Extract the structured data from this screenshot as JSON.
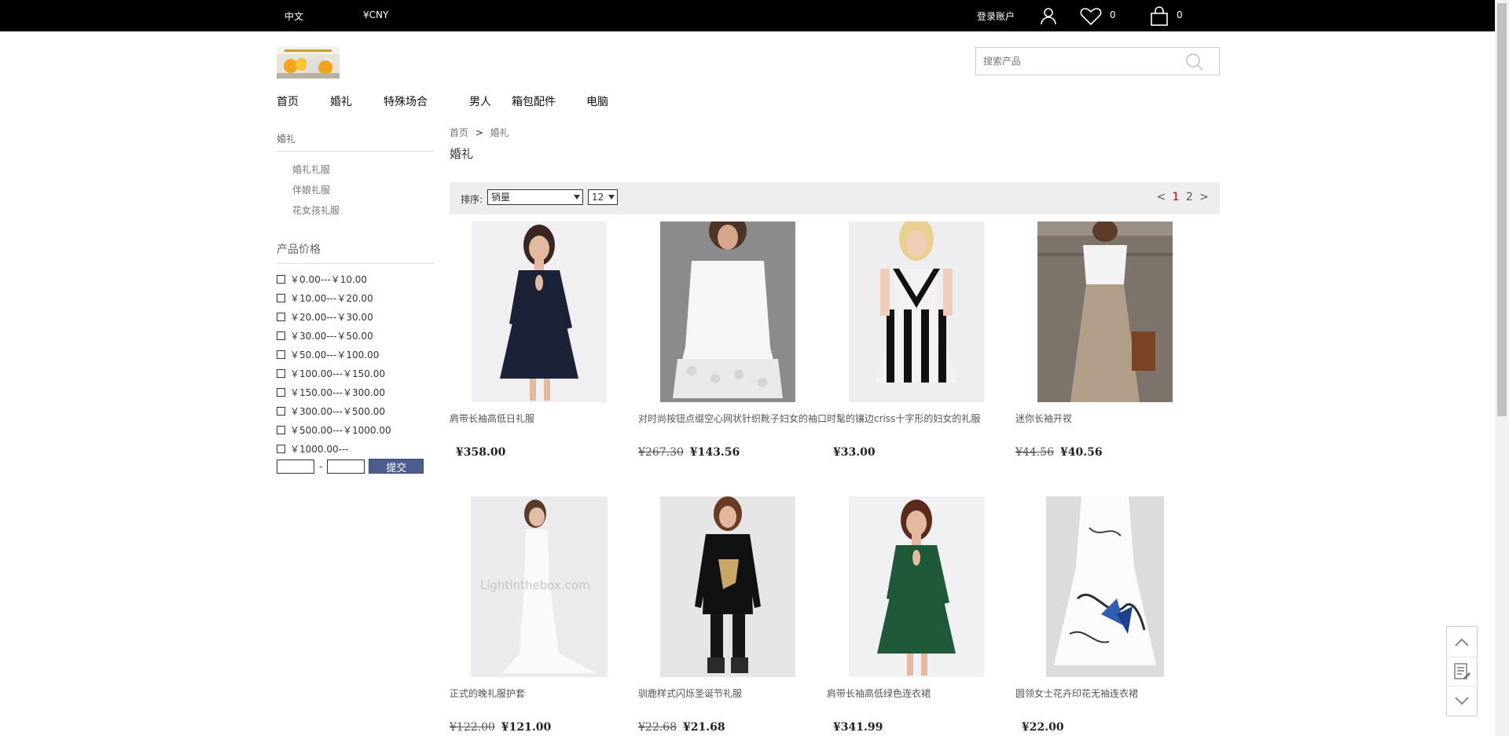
{
  "topbar": {
    "language": "中文",
    "currency": "¥CNY",
    "login": "登录账户",
    "wishlist_count": "0",
    "cart_count": "0"
  },
  "search": {
    "placeholder": "搜索产品"
  },
  "nav": [
    "首页",
    "婚礼",
    "特殊场合",
    "男人",
    "箱包配件",
    "电脑"
  ],
  "sidebar": {
    "category_title": "婚礼",
    "subcategories": [
      "婚礼礼服",
      "伴娘礼服",
      "花女孩礼服"
    ],
    "price_title": "产品价格",
    "price_ranges": [
      "￥0.00---￥10.00",
      "￥10.00---￥20.00",
      "￥20.00---￥30.00",
      "￥30.00---￥50.00",
      "￥50.00---￥100.00",
      "￥100.00---￥150.00",
      "￥150.00---￥300.00",
      "￥300.00---￥500.00",
      "￥500.00---￥1000.00",
      "￥1000.00---"
    ],
    "range_dash": "-",
    "submit_label": "提交"
  },
  "breadcrumb": {
    "home": "首页",
    "sep": ">",
    "current": "婚礼"
  },
  "page_title": "婚礼",
  "sortbar": {
    "label": "排序:",
    "sort_value": "销量",
    "page_size": "12",
    "prev": "<",
    "pages": [
      "1",
      "2"
    ],
    "current_page": "1",
    "next": ">"
  },
  "products": [
    {
      "name": "肩带长袖高低日礼服",
      "old_price": "",
      "price": "¥358.00",
      "image": "navy-dress"
    },
    {
      "name": "对时尚按钮点缀空心网状针织靴子妇女的袖口时髦的镶边criss十字形的妇女的礼服",
      "old_price": "¥267.30",
      "price": "¥143.56",
      "image": "white-lace-top"
    },
    {
      "name": "",
      "old_price": "",
      "price": "¥33.00",
      "image": "striped-dress"
    },
    {
      "name": "迷你长袖开衩",
      "old_price": "¥44.56",
      "price": "¥40.56",
      "image": "maxi-skirt"
    },
    {
      "name": "正式的晚礼服护套",
      "old_price": "¥122.00",
      "price": "¥121.00",
      "image": "white-gown"
    },
    {
      "name": "驯鹿样式闪烁圣诞节礼服",
      "old_price": "¥22.68",
      "price": "¥21.68",
      "image": "black-sweater"
    },
    {
      "name": "肩带长袖高低绿色连衣裙",
      "old_price": "",
      "price": "¥341.99",
      "image": "green-dress"
    },
    {
      "name": "圆领女士花卉印花无袖连衣裙",
      "old_price": "",
      "price": "¥22.00",
      "image": "butterfly-dress"
    }
  ],
  "colors": {
    "topbar": "#000000",
    "submit": "#4b5e8d",
    "current_page": "#c40000"
  }
}
